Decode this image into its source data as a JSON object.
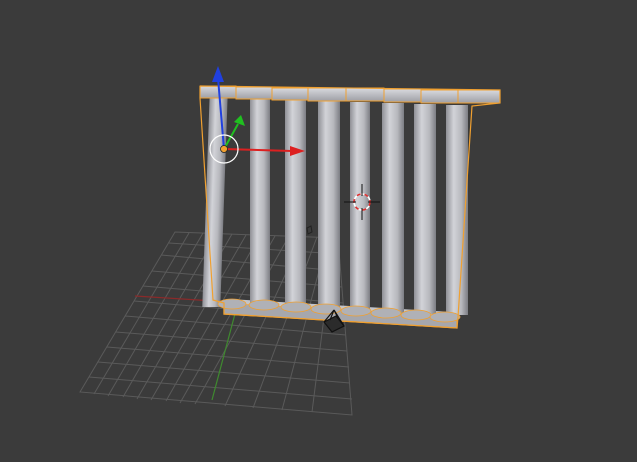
{
  "viewport": {
    "background": "#3b3b3b",
    "grid_color": "#555555",
    "x_axis_color": "#8a2a2a",
    "y_axis_color": "#3f8a2f",
    "selection_outline": "#f0a030",
    "column_count": 8
  },
  "gizmo": {
    "x_color": "#dd2020",
    "y_color": "#20c020",
    "z_color": "#2040e0"
  },
  "icons": {
    "cursor": "3d-cursor-icon",
    "camera": "camera-icon",
    "pivot": "object-origin-icon"
  }
}
